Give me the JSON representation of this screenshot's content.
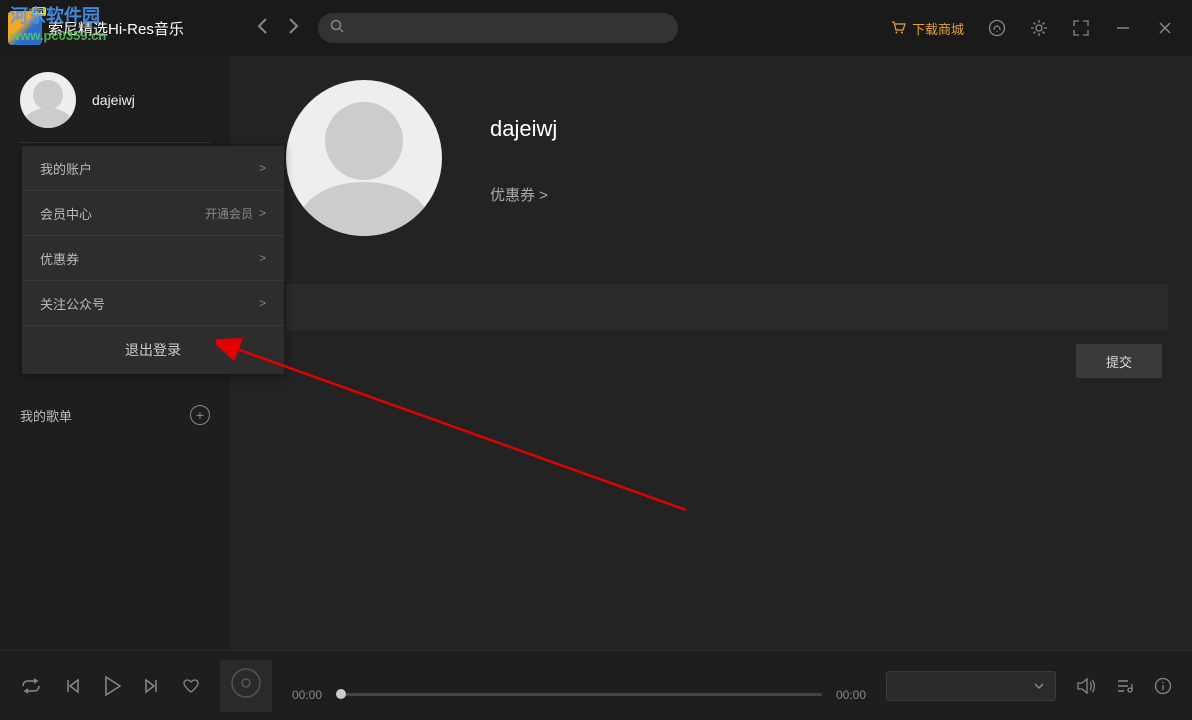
{
  "header": {
    "app_title": "索尼精选Hi-Res音乐",
    "logo_badge": "HR",
    "shop_label": "下载商城"
  },
  "watermark": {
    "line1": "河东软件园",
    "line2": "www.pc0359.cn"
  },
  "sidebar": {
    "username": "dajeiwj",
    "playlist_label": "我的歌单"
  },
  "dropdown": {
    "items": [
      {
        "label": "我的账户",
        "right": ""
      },
      {
        "label": "会员中心",
        "right": "开通会员"
      },
      {
        "label": "优惠券",
        "right": ""
      },
      {
        "label": "关注公众号",
        "right": ""
      }
    ],
    "logout": "退出登录"
  },
  "profile": {
    "username": "dajeiwj",
    "coupon_label": "优惠券 >"
  },
  "actions": {
    "submit": "提交"
  },
  "player": {
    "time_current": "00:00",
    "time_total": "00:00"
  },
  "colors": {
    "accent": "#e5a03c",
    "arrow": "#e30000"
  }
}
